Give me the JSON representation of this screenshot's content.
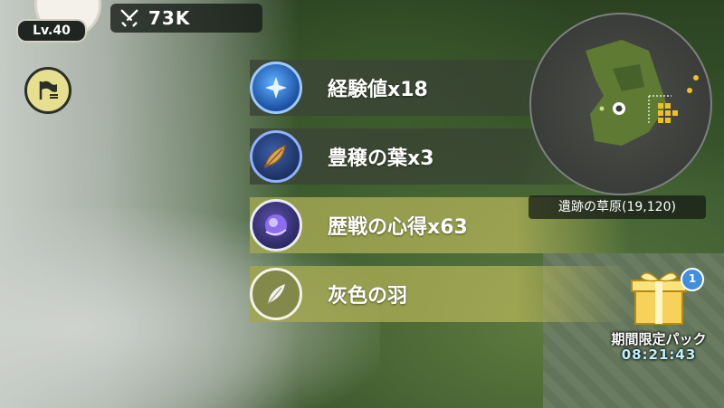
{
  "player": {
    "level": "Lv.40",
    "power": "73K"
  },
  "rewards": [
    {
      "label": "経験値x18",
      "icon": "exp-orb-icon"
    },
    {
      "label": "豊穣の葉x3",
      "icon": "leaf-icon"
    },
    {
      "label": "歴戦の心得x63",
      "icon": "purple-orb-icon"
    },
    {
      "label": "灰色の羽",
      "icon": "feather-icon"
    }
  ],
  "minimap": {
    "location": "遺跡の草原(19,120)"
  },
  "pack": {
    "title": "期間限定パック",
    "timer": "08:21:43",
    "badge": "1"
  },
  "colors": {
    "fog": "#cdd2cd",
    "highlight_band": "#b4b45a",
    "badge": "#3f8ee0",
    "timer": "#bff0ff"
  }
}
